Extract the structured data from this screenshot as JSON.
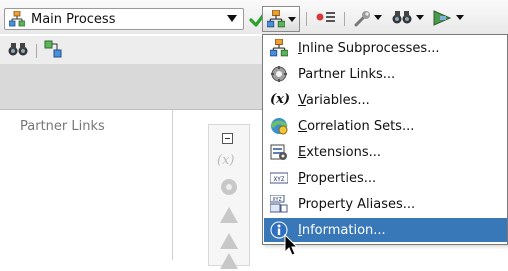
{
  "toolbar": {
    "process_select": {
      "value": "Main Process"
    }
  },
  "sidebar": {
    "partner_links_title": "Partner Links",
    "palette_icons": [
      "collapse-icon",
      "variable-icon",
      "gear-icon",
      "triangle-icon",
      "triangle-icon",
      "triangle-icon"
    ]
  },
  "menu": {
    "items": [
      {
        "mnemonic": "I",
        "rest": "nline Subprocesses...",
        "icon": "inline-subprocess-icon"
      },
      {
        "mnemonic": "",
        "rest": "Partner Links...",
        "icon": "partner-links-icon"
      },
      {
        "mnemonic": "V",
        "rest": "ariables...",
        "icon": "variables-icon"
      },
      {
        "mnemonic": "C",
        "rest": "orrelation Sets...",
        "icon": "correlation-sets-icon"
      },
      {
        "mnemonic": "E",
        "rest": "xtensions...",
        "icon": "extensions-icon"
      },
      {
        "mnemonic": "P",
        "rest": "roperties...",
        "icon": "properties-icon"
      },
      {
        "mnemonic": "",
        "rest": "Property Aliases...",
        "icon": "property-aliases-icon"
      },
      {
        "mnemonic": "I",
        "rest": "nformation...",
        "icon": "information-icon"
      }
    ],
    "selected_index": 7,
    "selected_color": "#3878b8"
  }
}
